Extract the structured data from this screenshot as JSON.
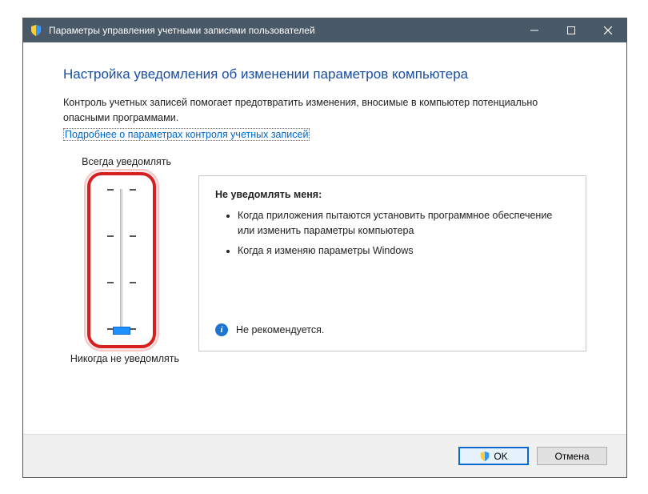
{
  "titlebar": {
    "title": "Параметры управления учетными записями пользователей"
  },
  "content": {
    "heading": "Настройка уведомления об изменении параметров компьютера",
    "description": "Контроль учетных записей помогает предотвратить изменения, вносимые в компьютер потенциально опасными программами.",
    "link": "Подробнее о параметрах контроля учетных записей"
  },
  "slider": {
    "label_top": "Всегда уведомлять",
    "label_bottom": "Никогда не уведомлять"
  },
  "info": {
    "title": "Не уведомлять меня:",
    "items": [
      "Когда приложения пытаются установить программное обеспечение или изменить параметры компьютера",
      "Когда я изменяю параметры Windows"
    ],
    "warning": "Не рекомендуется."
  },
  "footer": {
    "ok": "OK",
    "cancel": "Отмена"
  }
}
